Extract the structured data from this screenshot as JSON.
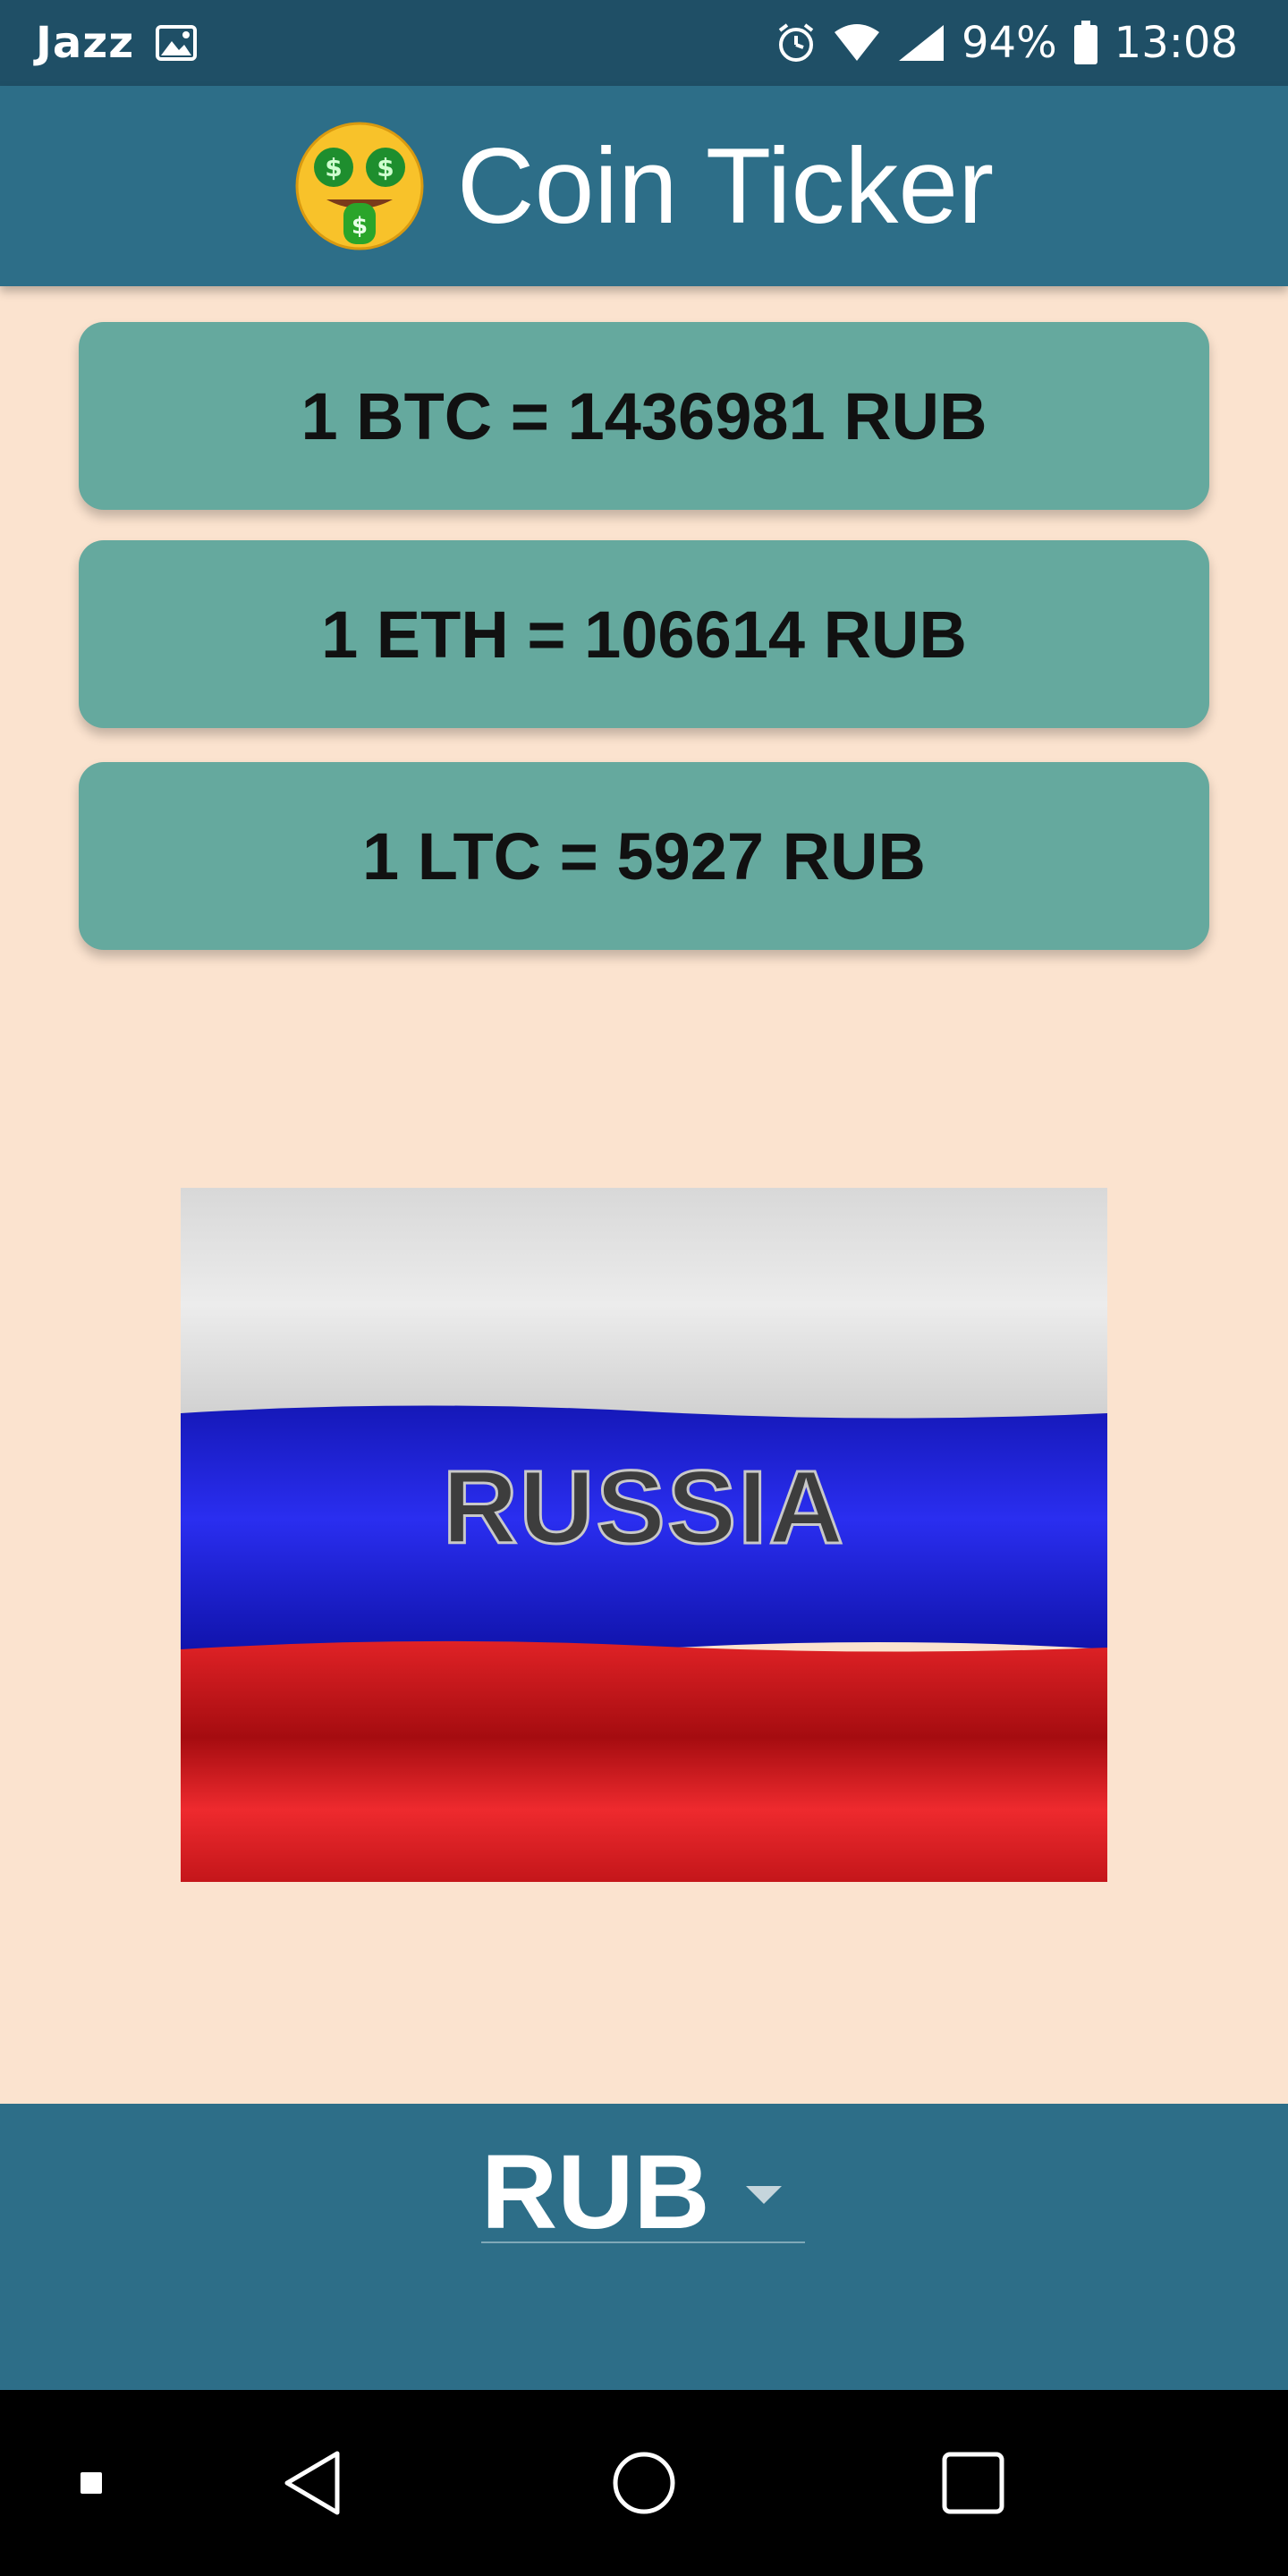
{
  "status_bar": {
    "carrier": "Jazz",
    "battery": "94%",
    "time": "13:08",
    "icons": [
      "image-icon",
      "alarm-icon",
      "wifi-icon",
      "signal-icon",
      "battery-icon"
    ]
  },
  "app_bar": {
    "emoji": "money-mouth-face-icon",
    "title": "Coin Ticker"
  },
  "rates": [
    {
      "text": "1 BTC = 1436981 RUB"
    },
    {
      "text": "1 ETH = 106614 RUB"
    },
    {
      "text": "1 LTC = 5927 RUB"
    }
  ],
  "flag": {
    "label": "RUSSIA",
    "colors": [
      "#e4e4e4",
      "#1c20d8",
      "#d81e22"
    ]
  },
  "picker": {
    "selected": "RUB"
  },
  "nav": {
    "icons": [
      "dot-icon",
      "back-icon",
      "home-icon",
      "recents-icon"
    ]
  },
  "colors": {
    "status_bar": "#1f4f66",
    "app_bar": "#2d6e88",
    "background": "#fbe3cf",
    "card": "#65a99e"
  }
}
